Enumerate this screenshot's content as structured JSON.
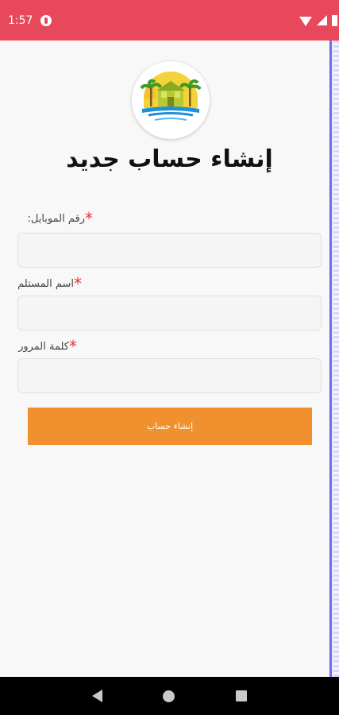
{
  "status_bar": {
    "time": "1:57"
  },
  "page": {
    "title": "إنشاء حساب جديد"
  },
  "form": {
    "fields": [
      {
        "label": "رقم الموبايل:",
        "value": "",
        "placeholder": ""
      },
      {
        "label": "اسم المستلم",
        "value": "",
        "placeholder": ""
      },
      {
        "label": "كلمة المرور",
        "value": "",
        "placeholder": ""
      }
    ],
    "required_mark": "*",
    "submit_label": "إنشاء حساب"
  },
  "colors": {
    "status_bar": "#e8485b",
    "button": "#f0902f",
    "required": "#e53935"
  },
  "icons": {
    "status": [
      "app-notification-icon",
      "wifi-icon",
      "signal-icon",
      "battery-icon"
    ],
    "logo": "palm-tree-hut-logo-icon",
    "nav": [
      "back-icon",
      "home-icon",
      "recent-apps-icon"
    ]
  }
}
